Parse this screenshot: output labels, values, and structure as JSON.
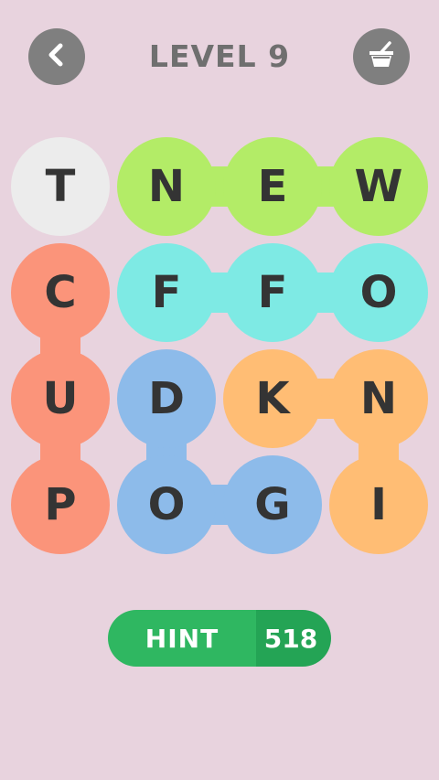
{
  "header": {
    "title": "LEVEL 9",
    "back_icon": "chevron-left-icon",
    "shop_icon": "basket-icon"
  },
  "colors": {
    "background": "#e8d3de",
    "button_gray": "#7f7f7f",
    "white": "#ececec",
    "green": "#b3ec67",
    "salmon": "#fb947a",
    "cyan": "#7eeae4",
    "blue": "#8dbbea",
    "orange": "#ffbd74",
    "hint_green": "#2fb761",
    "hint_green_dark": "#24a455"
  },
  "grid": {
    "rows": [
      [
        {
          "letter": "T",
          "color": "white"
        },
        {
          "letter": "N",
          "color": "green"
        },
        {
          "letter": "E",
          "color": "green"
        },
        {
          "letter": "W",
          "color": "green"
        }
      ],
      [
        {
          "letter": "C",
          "color": "salmon"
        },
        {
          "letter": "F",
          "color": "cyan"
        },
        {
          "letter": "F",
          "color": "cyan"
        },
        {
          "letter": "O",
          "color": "cyan"
        }
      ],
      [
        {
          "letter": "U",
          "color": "salmon"
        },
        {
          "letter": "D",
          "color": "blue"
        },
        {
          "letter": "K",
          "color": "orange"
        },
        {
          "letter": "N",
          "color": "orange"
        }
      ],
      [
        {
          "letter": "P",
          "color": "salmon"
        },
        {
          "letter": "O",
          "color": "blue"
        },
        {
          "letter": "G",
          "color": "blue"
        },
        {
          "letter": "I",
          "color": "orange"
        }
      ]
    ],
    "links": [
      {
        "from": [
          0,
          1
        ],
        "to": [
          0,
          2
        ],
        "color": "green"
      },
      {
        "from": [
          0,
          2
        ],
        "to": [
          0,
          3
        ],
        "color": "green"
      },
      {
        "from": [
          1,
          0
        ],
        "to": [
          2,
          0
        ],
        "color": "salmon"
      },
      {
        "from": [
          2,
          0
        ],
        "to": [
          3,
          0
        ],
        "color": "salmon"
      },
      {
        "from": [
          1,
          1
        ],
        "to": [
          1,
          2
        ],
        "color": "cyan"
      },
      {
        "from": [
          1,
          2
        ],
        "to": [
          1,
          3
        ],
        "color": "cyan"
      },
      {
        "from": [
          2,
          1
        ],
        "to": [
          3,
          1
        ],
        "color": "blue"
      },
      {
        "from": [
          3,
          1
        ],
        "to": [
          3,
          2
        ],
        "color": "blue"
      },
      {
        "from": [
          2,
          2
        ],
        "to": [
          2,
          3
        ],
        "color": "orange"
      },
      {
        "from": [
          2,
          3
        ],
        "to": [
          3,
          3
        ],
        "color": "orange"
      }
    ]
  },
  "hint": {
    "label": "HINT",
    "count": "518"
  }
}
